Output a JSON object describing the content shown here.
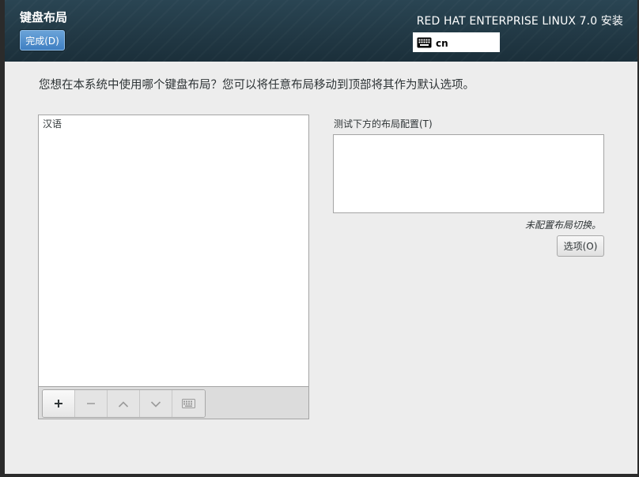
{
  "header": {
    "title": "键盘布局",
    "done_label": "完成(D)",
    "product": "RED HAT ENTERPRISE LINUX 7.0 安装",
    "layout_indicator": "cn"
  },
  "main": {
    "prompt": "您想在本系统中使用哪个键盘布局？您可以将任意布局移动到顶部将其作为默认选项。",
    "layouts": [
      "汉语"
    ],
    "toolbar": {
      "add": "add-icon",
      "remove": "remove-icon",
      "move_up": "chevron-up-icon",
      "move_down": "chevron-down-icon",
      "preview": "keyboard-icon"
    },
    "test_label": "测试下方的布局配置(T)",
    "test_value": "",
    "switch_note": "未配置布局切换。",
    "options_label": "选项(O)"
  },
  "colors": {
    "header_bg": "#1f3541",
    "accent": "#3f7fc2",
    "content_bg": "#ededed"
  }
}
